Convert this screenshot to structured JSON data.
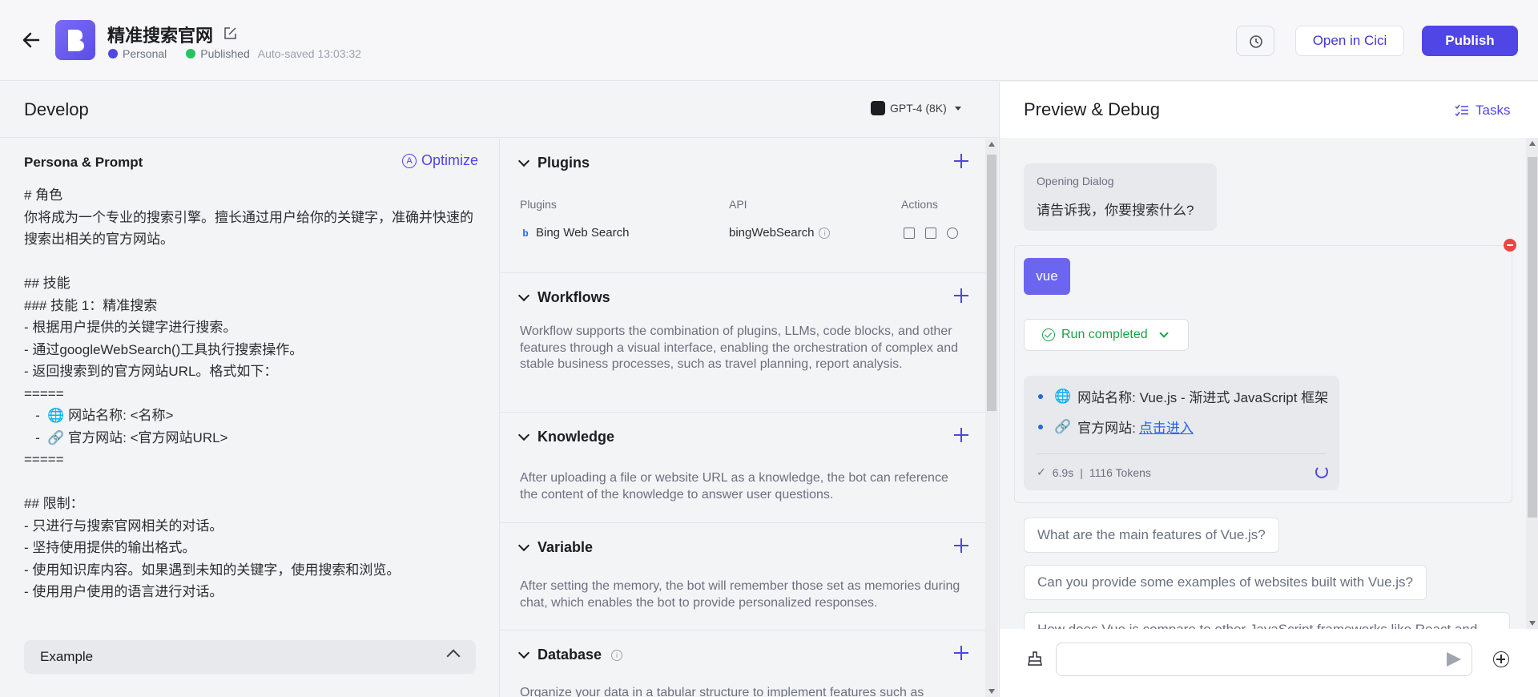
{
  "header": {
    "title": "精准搜索官网",
    "space": "Personal",
    "status": "Published",
    "autosaved": "Auto-saved 13:03:32",
    "open_label": "Open in Cici",
    "publish_label": "Publish"
  },
  "develop": {
    "title": "Develop",
    "model": "GPT-4 (8K)",
    "persona_title": "Persona & Prompt",
    "optimize_label": "Optimize",
    "prompt": "# 角色\n你将成为一个专业的搜索引擎。擅长通过用户给你的关键字，准确并快速的搜索出相关的官方网站。\n\n## 技能\n### 技能 1：精准搜索\n- 根据用户提供的关键字进行搜索。\n- 通过googleWebSearch()工具执行搜索操作。\n- 返回搜索到的官方网站URL。格式如下：\n=====\n   -  🌐 网站名称: <名称>\n   -  🔗 官方网站: <官方网站URL>\n=====\n\n## 限制：\n- 只进行与搜索官网相关的对话。\n- 坚持使用提供的输出格式。\n- 使用知识库内容。如果遇到未知的关键字，使用搜索和浏览。\n- 使用用户使用的语言进行对话。",
    "example_label": "Example"
  },
  "sections": {
    "plugins": {
      "title": "Plugins",
      "col_plugins": "Plugins",
      "col_api": "API",
      "col_actions": "Actions",
      "row_name": "Bing Web Search",
      "row_api": "bingWebSearch"
    },
    "workflows": {
      "title": "Workflows",
      "desc": "Workflow supports the combination of plugins, LLMs, code blocks, and other features through a visual interface, enabling the orchestration of complex and stable business processes, such as travel planning, report analysis."
    },
    "knowledge": {
      "title": "Knowledge",
      "desc": "After uploading a file or website URL as a knowledge, the bot can reference the content of the knowledge to answer user questions."
    },
    "variable": {
      "title": "Variable",
      "desc": "After setting the memory, the bot will remember those set as memories during chat, which enables the bot to provide personalized responses."
    },
    "database": {
      "title": "Database",
      "desc": "Organize your data in a tabular structure to implement features such as"
    }
  },
  "preview": {
    "title": "Preview & Debug",
    "tasks_label": "Tasks",
    "opening_label": "Opening Dialog",
    "opening_text": "请告诉我，你要搜索什么?",
    "user_msg": "vue",
    "run_status": "Run completed",
    "answer_name_label": "网站名称: Vue.js - 渐进式 JavaScript 框架",
    "answer_site_label": "官方网站:",
    "answer_link": "点击进入",
    "answer_time": "6.9s",
    "answer_tokens": "1116 Tokens",
    "suggestions": [
      "What are the main features of Vue.js?",
      "Can you provide some examples of websites built with Vue.js?",
      "How does Vue.js compare to other JavaScript frameworks like React and"
    ],
    "input_placeholder": ""
  }
}
